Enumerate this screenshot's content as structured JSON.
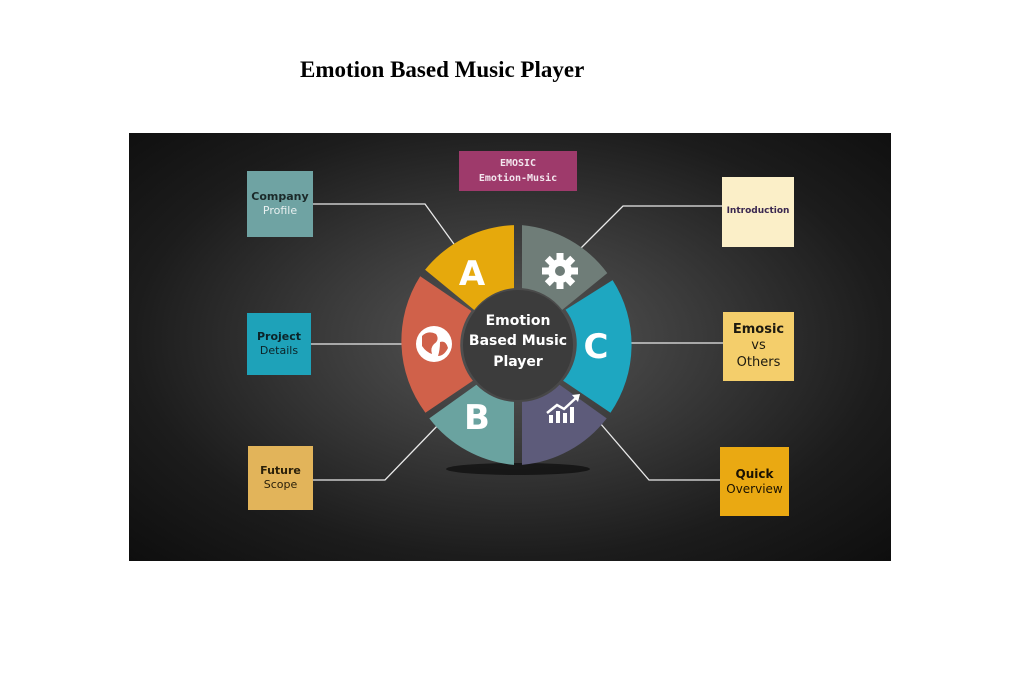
{
  "title": "Emotion Based Music Player",
  "banner": {
    "line1": "EMOSIC",
    "line2": "Emotion-Music"
  },
  "center": {
    "line1": "Emotion",
    "line2": "Based Music",
    "line3": "Player"
  },
  "segments": {
    "a_label": "A",
    "b_label": "B",
    "c_label": "C",
    "gear_icon": "gear-icon",
    "globe_icon": "globe-icon",
    "chart_icon": "growth-chart-icon"
  },
  "boxes": {
    "company": {
      "bold": "Company",
      "rest": "Profile"
    },
    "project": {
      "bold": "Project",
      "rest": "Details"
    },
    "future": {
      "bold": "Future",
      "rest": "Scope"
    },
    "intro": {
      "bold": "Introduction"
    },
    "emosic": {
      "bold": "Emosic",
      "mid": "vs",
      "rest": "Others"
    },
    "quick": {
      "bold": "Quick",
      "rest": "Overview"
    }
  },
  "colors": {
    "yellow": "#e6a90c",
    "slate": "#6f7d78",
    "cyan": "#1ea7c1",
    "purple": "#5d5b7a",
    "teal": "#6aa3a0",
    "red": "#d0614a",
    "magenta": "#9e3a6b"
  }
}
